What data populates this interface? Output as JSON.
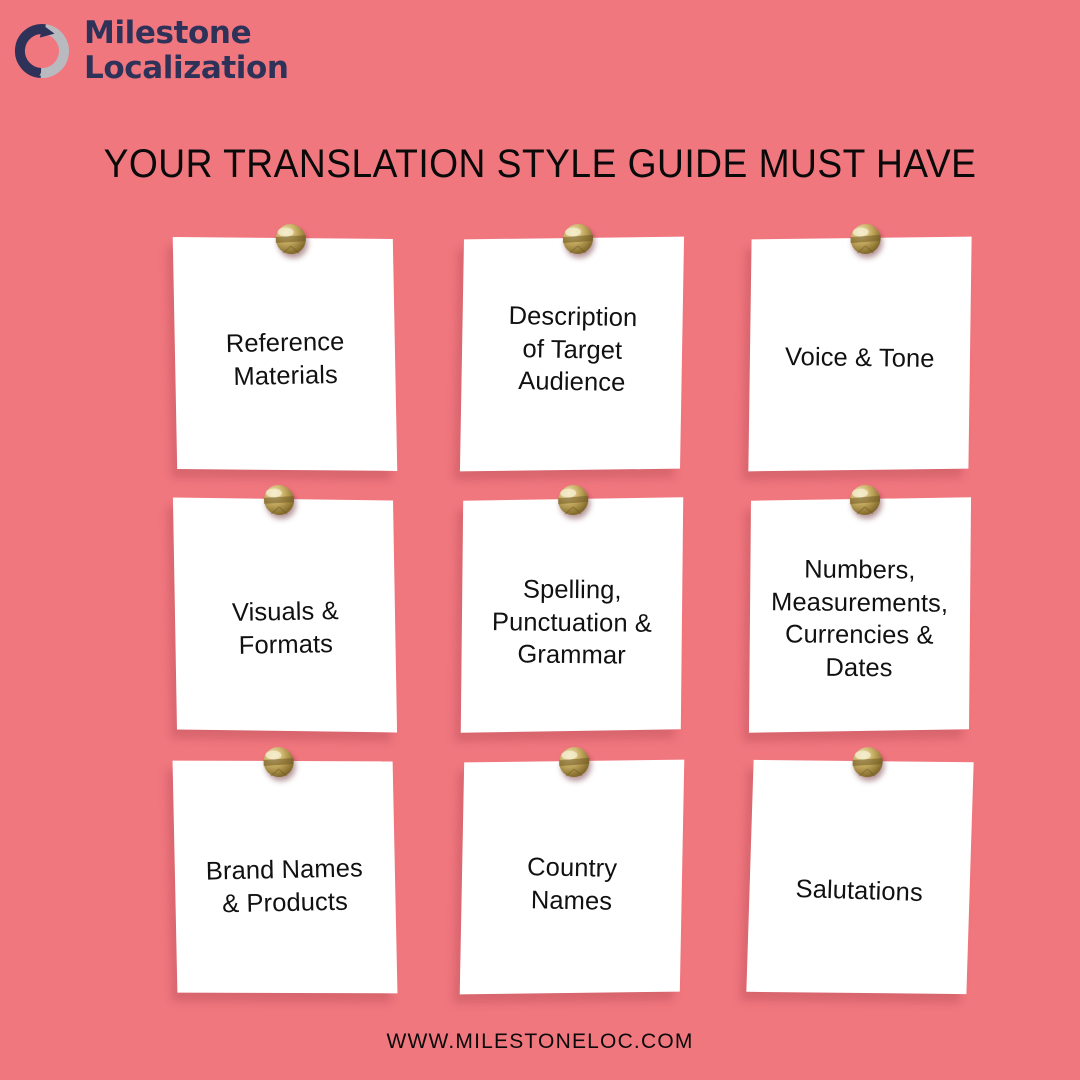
{
  "background_color": "#F1777F",
  "brand": {
    "logo_icon": "circular-arrow-logo-icon",
    "logo_mark_dark_color": "#2E3259",
    "logo_mark_gray_color": "#B9BAC0",
    "name_line_1": "Milestone",
    "name_line_2": "Localization",
    "text_color": "#2E3259"
  },
  "header": {
    "title": "YOUR TRANSLATION STYLE GUIDE MUST HAVE",
    "title_color": "#0A0A0A"
  },
  "notes": {
    "paper_color": "#FFFFFF",
    "text_color": "#111111",
    "pin_icon": "push-pin-icon",
    "pin_gold_light": "#E4D29A",
    "pin_gold_mid": "#BFA martial",
    "items": [
      {
        "label": "Reference\nMaterials",
        "lines": 2
      },
      {
        "label": "Description\nof Target\nAudience",
        "lines": 3
      },
      {
        "label": "Voice & Tone",
        "lines": 1
      },
      {
        "label": "Visuals &\nFormats",
        "lines": 2
      },
      {
        "label": "Spelling,\nPunctuation &\nGrammar",
        "lines": 3
      },
      {
        "label": "Numbers,\nMeasurements,\nCurrencies &\nDates",
        "lines": 4
      },
      {
        "label": "Brand Names\n& Products",
        "lines": 2
      },
      {
        "label": "Country\nNames",
        "lines": 2
      },
      {
        "label": "Salutations",
        "lines": 1
      }
    ]
  },
  "footer": {
    "website": "WWW.MILESTONELOC.COM",
    "color": "#0A0A0A"
  }
}
